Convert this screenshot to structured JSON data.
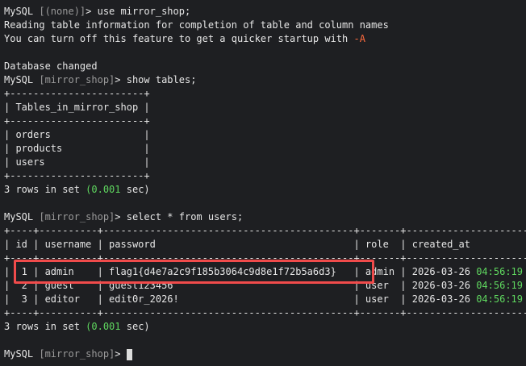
{
  "colors": {
    "background": "#1e1f22",
    "text": "#e6e6e6",
    "dim": "#9a9a9a",
    "green": "#5fd75f",
    "flag": "#ff6b3d",
    "highlight_border": "#f04b4b"
  },
  "lines": [
    [
      {
        "t": "MySQL "
      },
      {
        "t": "[(none)]",
        "c": "dim"
      },
      {
        "t": "> use mirror_shop;"
      }
    ],
    [
      {
        "t": "Reading table information for completion of table and column names"
      }
    ],
    [
      {
        "t": "You can turn off this feature to get a quicker startup with "
      },
      {
        "t": "-A",
        "c": "orange"
      }
    ],
    [
      {
        "t": ""
      }
    ],
    [
      {
        "t": "Database changed"
      }
    ],
    [
      {
        "t": "MySQL "
      },
      {
        "t": "[mirror_shop]",
        "c": "dim"
      },
      {
        "t": "> show tables;"
      }
    ],
    [
      {
        "t": "+-----------------------+"
      }
    ],
    [
      {
        "t": "| Tables_in_mirror_shop |"
      }
    ],
    [
      {
        "t": "+-----------------------+"
      }
    ],
    [
      {
        "t": "| orders                |"
      }
    ],
    [
      {
        "t": "| products              |"
      }
    ],
    [
      {
        "t": "| users                 |"
      }
    ],
    [
      {
        "t": "+-----------------------+"
      }
    ],
    [
      {
        "t": "3 rows in set "
      },
      {
        "t": "(0.001",
        "c": "green"
      },
      {
        "t": " sec)"
      }
    ],
    [
      {
        "t": ""
      }
    ],
    [
      {
        "t": "MySQL "
      },
      {
        "t": "[mirror_shop]",
        "c": "dim"
      },
      {
        "t": "> select * from users;"
      }
    ],
    [
      {
        "t": "+----+----------+-------------------------------------------+-------+---------------------+"
      }
    ],
    [
      {
        "t": "| id | username | password                                  | role  | created_at          |"
      }
    ],
    [
      {
        "t": "+----+----------+-------------------------------------------+-------+---------------------+"
      }
    ],
    [
      {
        "t": "|  1 | admin    | flag1{d4e7a2c9f185b3064c9d8e1f72b5a6d3}   | admin | 2026-03-26 "
      },
      {
        "t": "04:56:19",
        "c": "green"
      },
      {
        "t": " |"
      }
    ],
    [
      {
        "t": "|  2 | guest    | guest123456                               | user  | 2026-03-26 "
      },
      {
        "t": "04:56:19",
        "c": "green"
      },
      {
        "t": " |"
      }
    ],
    [
      {
        "t": "|  3 | editor   | edit0r_2026!                              | user  | 2026-03-26 "
      },
      {
        "t": "04:56:19",
        "c": "green"
      },
      {
        "t": " |"
      }
    ],
    [
      {
        "t": "+----+----------+-------------------------------------------+-------+---------------------+"
      }
    ],
    [
      {
        "t": "3 rows in set "
      },
      {
        "t": "(0.001",
        "c": "green"
      },
      {
        "t": " sec)"
      }
    ],
    [
      {
        "t": ""
      }
    ],
    [
      {
        "t": "MySQL "
      },
      {
        "t": "[mirror_shop]",
        "c": "dim"
      },
      {
        "t": "> "
      }
    ]
  ]
}
